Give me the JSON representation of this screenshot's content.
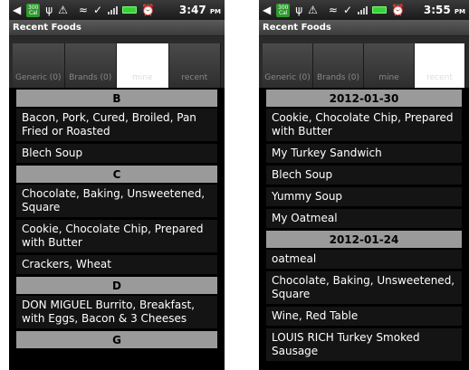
{
  "left_screen": {
    "status": {
      "battery_badge": "300",
      "battery_badge_unit": "Cal",
      "time": "3:47",
      "ampm": "PM"
    },
    "title": "Recent Foods",
    "tabs": [
      {
        "label": "Generic (0)",
        "active": false
      },
      {
        "label": "Brands (0)",
        "active": false
      },
      {
        "label": "mine",
        "active": true
      },
      {
        "label": "recent",
        "active": false
      }
    ],
    "rows": [
      {
        "type": "header",
        "text": "B"
      },
      {
        "type": "item",
        "text": "Bacon, Pork, Cured, Broiled, Pan Fried or Roasted"
      },
      {
        "type": "item",
        "text": "Blech Soup"
      },
      {
        "type": "header",
        "text": "C"
      },
      {
        "type": "item",
        "text": "Chocolate, Baking, Unsweetened, Square"
      },
      {
        "type": "item",
        "text": "Cookie, Chocolate Chip, Prepared with Butter"
      },
      {
        "type": "item",
        "text": "Crackers, Wheat"
      },
      {
        "type": "header",
        "text": "D"
      },
      {
        "type": "item",
        "text": "DON MIGUEL Burrito, Breakfast, with Eggs, Bacon & 3 Cheeses"
      },
      {
        "type": "header",
        "text": "G"
      }
    ]
  },
  "right_screen": {
    "status": {
      "battery_badge": "300",
      "battery_badge_unit": "Cal",
      "time": "3:55",
      "ampm": "PM"
    },
    "title": "Recent Foods",
    "tabs": [
      {
        "label": "Generic (0)",
        "active": false
      },
      {
        "label": "Brands (0)",
        "active": false
      },
      {
        "label": "mine",
        "active": false
      },
      {
        "label": "recent",
        "active": true
      }
    ],
    "rows": [
      {
        "type": "header",
        "text": "2012-01-30"
      },
      {
        "type": "item",
        "text": "Cookie, Chocolate Chip, Prepared with Butter"
      },
      {
        "type": "item",
        "text": "My Turkey Sandwich"
      },
      {
        "type": "item",
        "text": "Blech Soup"
      },
      {
        "type": "item",
        "text": "Yummy Soup"
      },
      {
        "type": "item",
        "text": "My Oatmeal"
      },
      {
        "type": "header",
        "text": "2012-01-24"
      },
      {
        "type": "item",
        "text": "oatmeal"
      },
      {
        "type": "item",
        "text": "Chocolate, Baking, Unsweetened, Square"
      },
      {
        "type": "item",
        "text": "Wine, Red Table"
      },
      {
        "type": "item",
        "text": "LOUIS RICH Turkey Smoked Sausage"
      }
    ]
  }
}
